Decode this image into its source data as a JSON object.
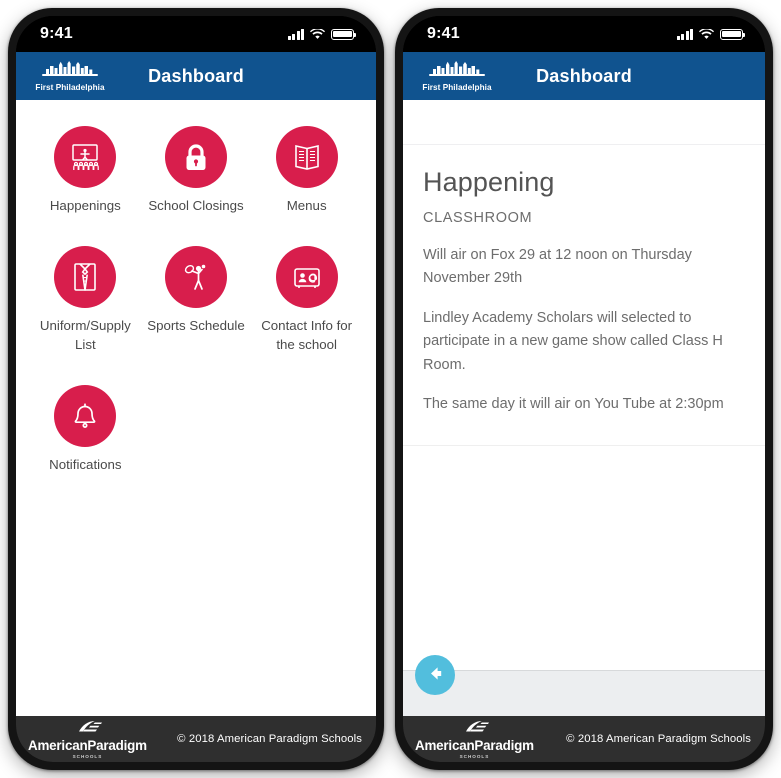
{
  "accent": {
    "tile_red": "#d81e4c",
    "header_blue": "#10538f",
    "footer_dark": "#2f2f2f",
    "back_button_blue": "#52bedd",
    "backbar_gray": "#eceef0"
  },
  "status_bar": {
    "time": "9:41",
    "signal_icon": "cellular-bars-icon",
    "wifi_icon": "wifi-icon",
    "battery_icon": "battery-full-icon"
  },
  "app_header": {
    "logo_icon": "philadelphia-skyline-icon",
    "brand_name": "First Philadelphia",
    "title": "Dashboard"
  },
  "dashboard": {
    "tiles": [
      {
        "label": "Happenings",
        "icon": "presentation-audience-icon"
      },
      {
        "label": "School Closings",
        "icon": "padlock-icon"
      },
      {
        "label": "Menus",
        "icon": "open-book-menu-icon"
      },
      {
        "label": "Uniform/Supply List",
        "icon": "shirt-tie-icon"
      },
      {
        "label": "Sports Schedule",
        "icon": "tennis-player-icon"
      },
      {
        "label": "Contact Info for the school",
        "icon": "contact-card-icon"
      },
      {
        "label": "Notifications",
        "icon": "bell-icon"
      }
    ]
  },
  "article": {
    "title": "Happening",
    "subtitle": "CLASSHROOM",
    "paragraphs": [
      "Will air on Fox 29 at 12 noon on Thursday November 29th",
      "Lindley Academy Scholars will selected to participate in a new game show called Class H Room.",
      "The same day it will air on You Tube at 2:30pm"
    ],
    "back_button_icon": "arrow-left-icon"
  },
  "footer": {
    "logo_icon": "american-paradigm-books-icon",
    "brand_name": "AmericanParadigm",
    "brand_sub": "SCHOOLS",
    "copyright": "© 2018 American Paradigm Schools"
  }
}
